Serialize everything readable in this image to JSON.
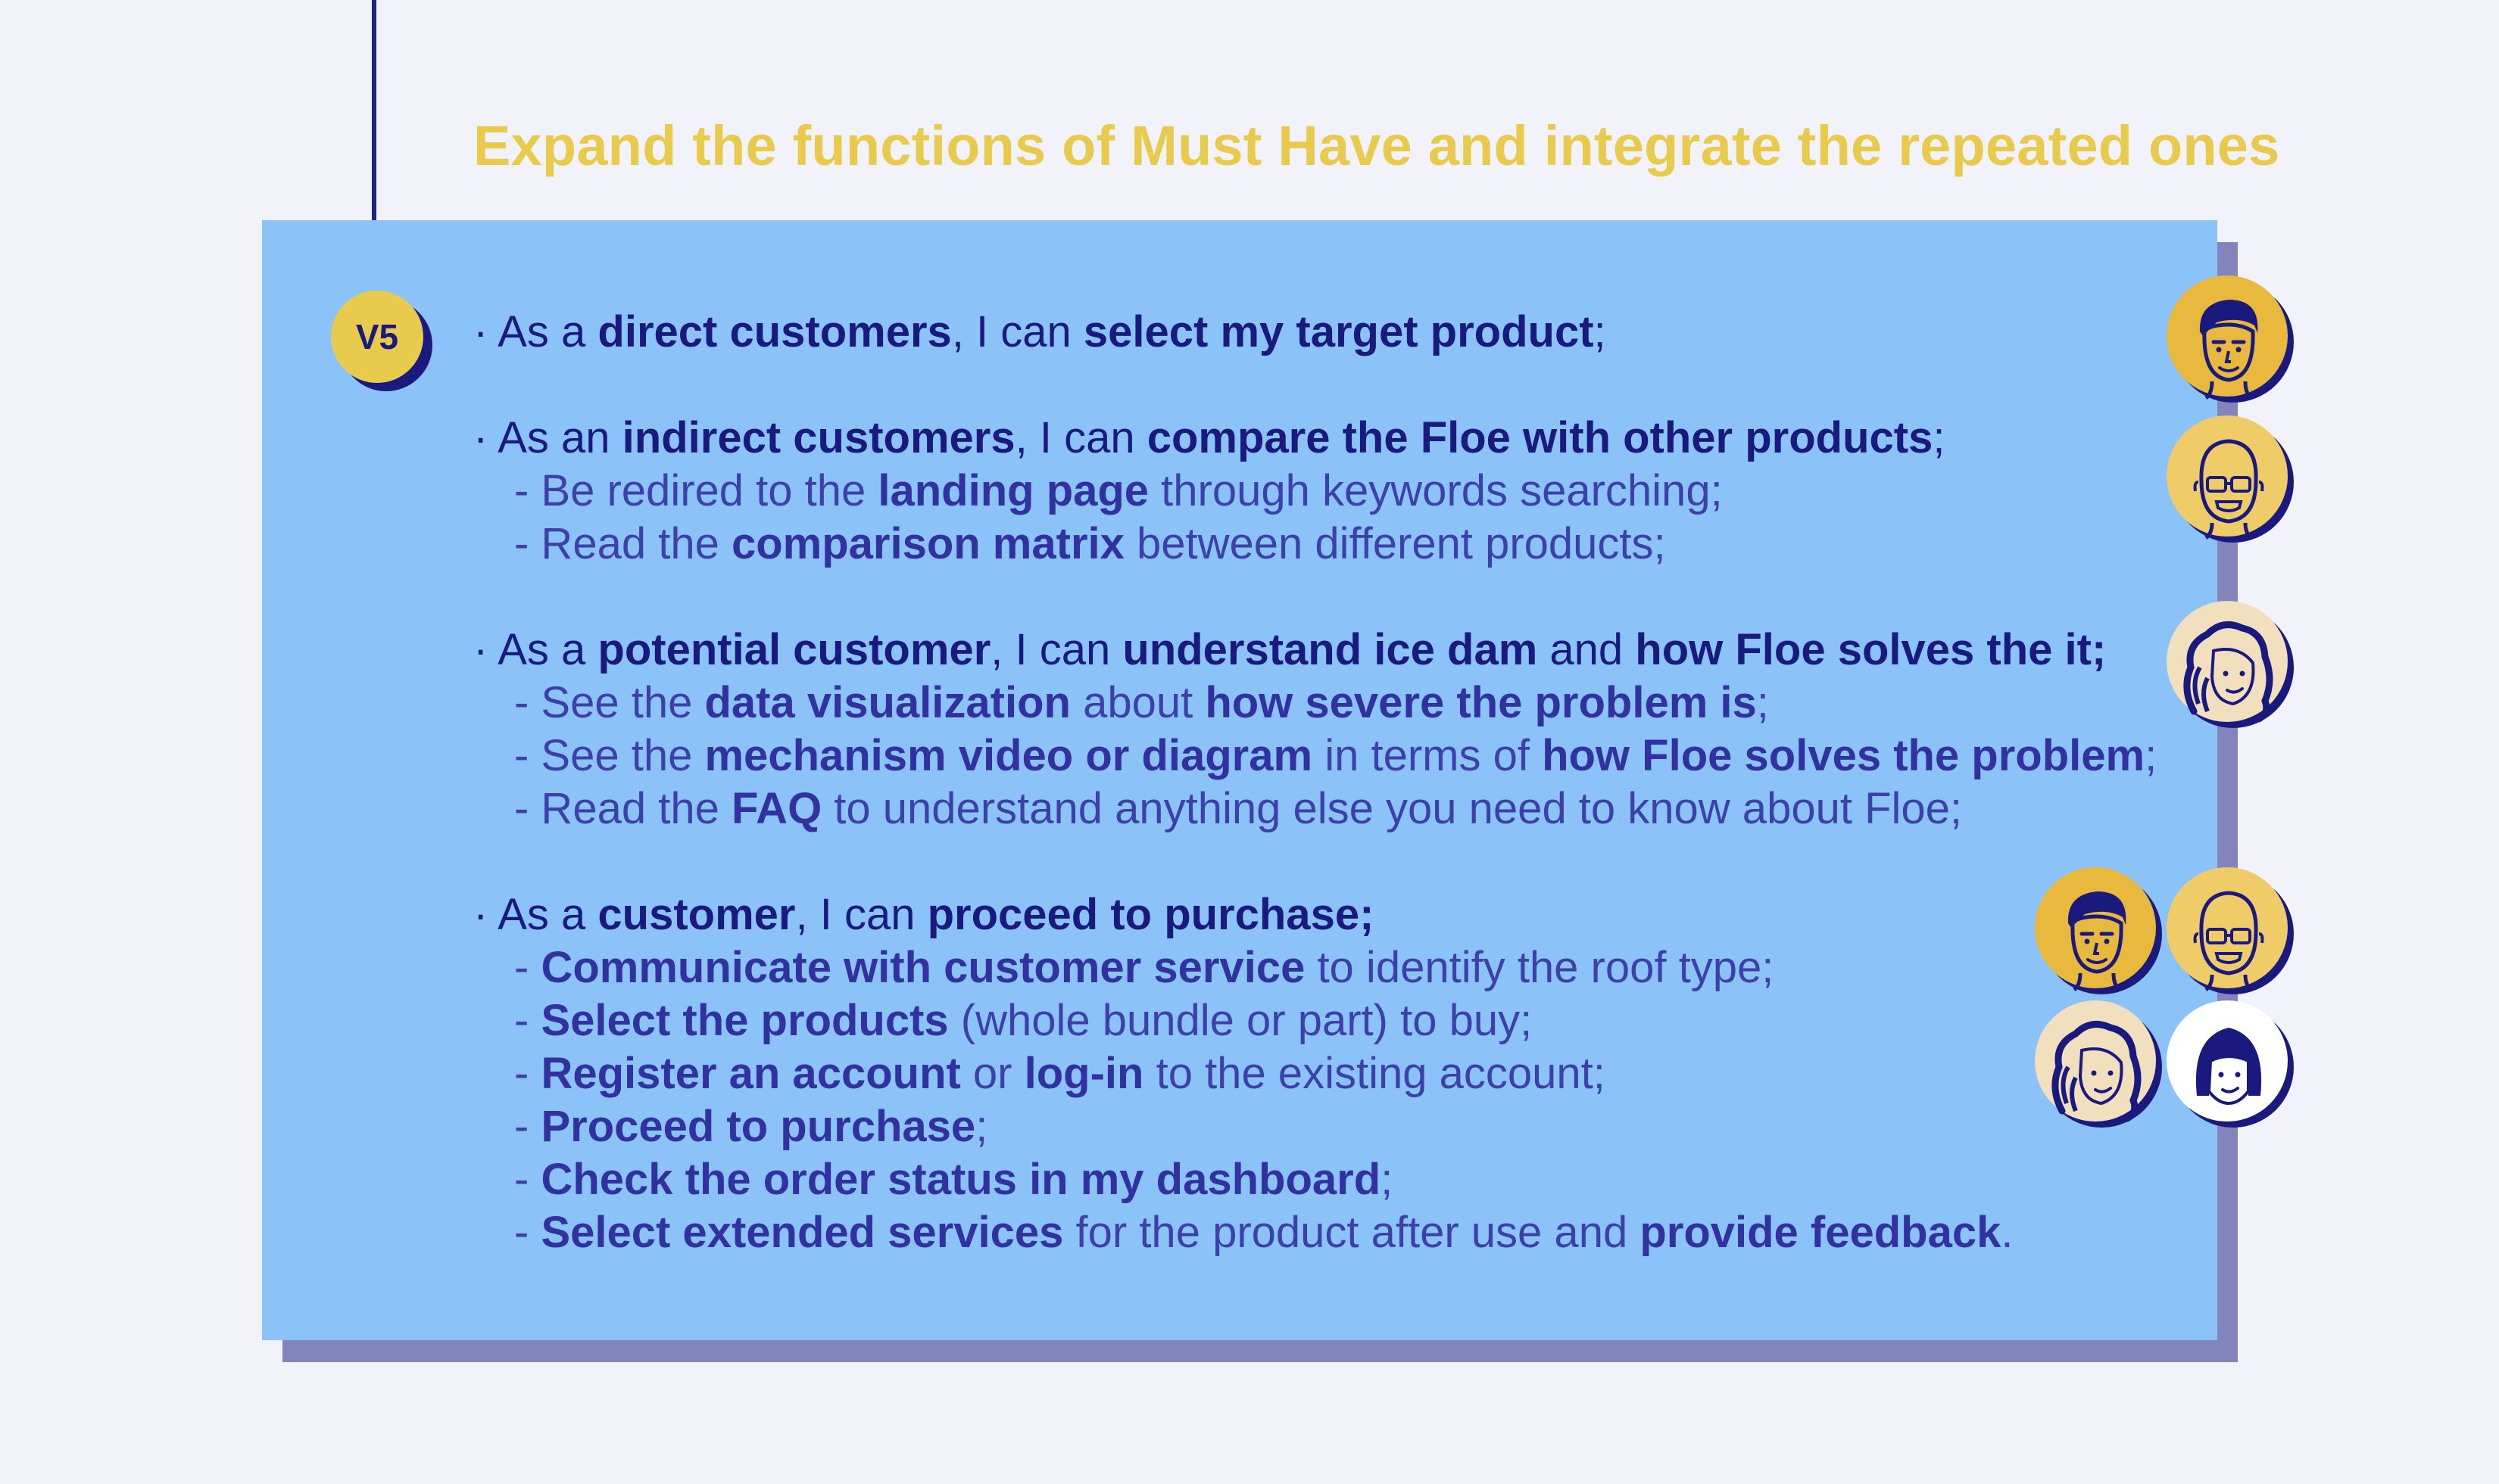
{
  "title": "Expand the functions of Must Have and integrate the repeated ones",
  "badge": "V5",
  "colors": {
    "background": "#f2f3fa",
    "title": "#e8cb4c",
    "panel": "#8bc3f9",
    "panel_shadow": "#8484bd",
    "navy": "#1a1a7e",
    "sub_text": "#3d40a8"
  },
  "stories": {
    "s1": {
      "intro": "· As a ",
      "role": "direct customers",
      "mid": ", I can ",
      "goal": "select my target product",
      "end": ";"
    },
    "s2": {
      "intro": "· As an ",
      "role": "indirect customers",
      "mid": ", I can ",
      "goal": "compare the Floe with other products",
      "end": ";",
      "sub1": {
        "a": "- Be redired to the ",
        "b": "landing page",
        "c": " through keywords searching;"
      },
      "sub2": {
        "a": "- Read the ",
        "b": "comparison matrix",
        "c": " between different products;"
      }
    },
    "s3": {
      "intro": "· As a ",
      "role": "potential customer",
      "mid": ", I can ",
      "goal": "understand ice dam",
      "and": " and ",
      "goal2": "how Floe solves the it;",
      "sub1": {
        "a": "- See the ",
        "b": "data visualization",
        "c": " about ",
        "d": "how severe the problem is",
        "e": ";"
      },
      "sub2": {
        "a": "- See the ",
        "b": "mechanism video or diagram",
        "c": " in terms of ",
        "d": "how Floe solves the problem",
        "e": ";"
      },
      "sub3": {
        "a": "- Read the ",
        "b": "FAQ",
        "c": " to understand anything else you need to know about Floe;"
      }
    },
    "s4": {
      "intro": "· As a ",
      "role": "customer",
      "mid": ", I can ",
      "goal": "proceed to purchase;",
      "sub1": {
        "a": "- ",
        "b": "Communicate with customer service",
        "c": " to identify the roof type;"
      },
      "sub2": {
        "a": "- ",
        "b": "Select the products",
        "c": " (whole bundle or part) to buy;"
      },
      "sub3": {
        "a": "- ",
        "b": "Register an account",
        "c": " or ",
        "d": "log-in",
        "e": " to the existing account;"
      },
      "sub4": {
        "a": "- ",
        "b": "Proceed to purchase",
        "c": ";"
      },
      "sub5": {
        "a": "- ",
        "b": "Check the order status in my dashboard",
        "c": ";"
      },
      "sub6": {
        "a": "- ",
        "b": "Select extended services",
        "c": " for the product after use and ",
        "d": "provide feedback",
        "e": "."
      }
    }
  },
  "avatars": [
    {
      "icon": "man-short-hair-avatar-icon",
      "color": "#e8b93c"
    },
    {
      "icon": "bald-man-glasses-avatar-icon",
      "color": "#f0cc68"
    },
    {
      "icon": "curly-hair-woman-avatar-icon",
      "color": "#f1dfbe"
    },
    {
      "icon": "bob-hair-woman-avatar-icon",
      "color": "#ffffff"
    }
  ]
}
